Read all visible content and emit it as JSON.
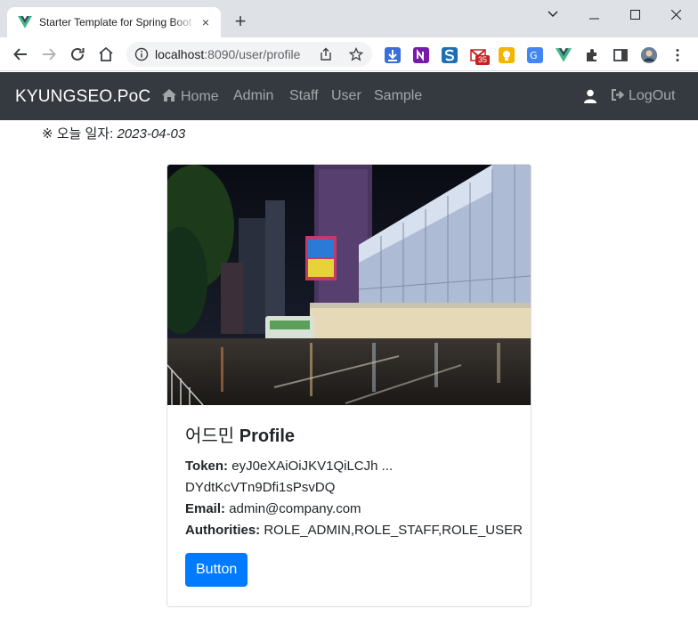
{
  "browser": {
    "tab_title": "Starter Template for Spring Boot",
    "tab_close": "×",
    "new_tab": "+",
    "url_host": "localhost",
    "url_rest": ":8090/user/profile",
    "gmail_badge": "35"
  },
  "navbar": {
    "brand": "KYUNGSEO.PoC",
    "items": [
      "Home",
      "Admin",
      "Staff",
      "User",
      "Sample"
    ],
    "logout": "LogOut"
  },
  "today": {
    "label": "※ 오늘 일자: ",
    "date": "2023-04-03"
  },
  "profile": {
    "title_name": "어드민",
    "title_suffix": "Profile",
    "token_label": "Token:",
    "token_value": "eyJ0eXAiOiJKV1QiLCJh ...",
    "token_value_2": "DYdtKcVTn9Dfi1sPsvDQ",
    "email_label": "Email:",
    "email_value": "admin@company.com",
    "authorities_label": "Authorities:",
    "authorities_value": "ROLE_ADMIN,ROLE_STAFF,ROLE_USER",
    "button": "Button"
  },
  "colors": {
    "navbar_bg": "#343a40",
    "button_primary": "#007bff",
    "chrome_frame": "#dee1e6"
  }
}
